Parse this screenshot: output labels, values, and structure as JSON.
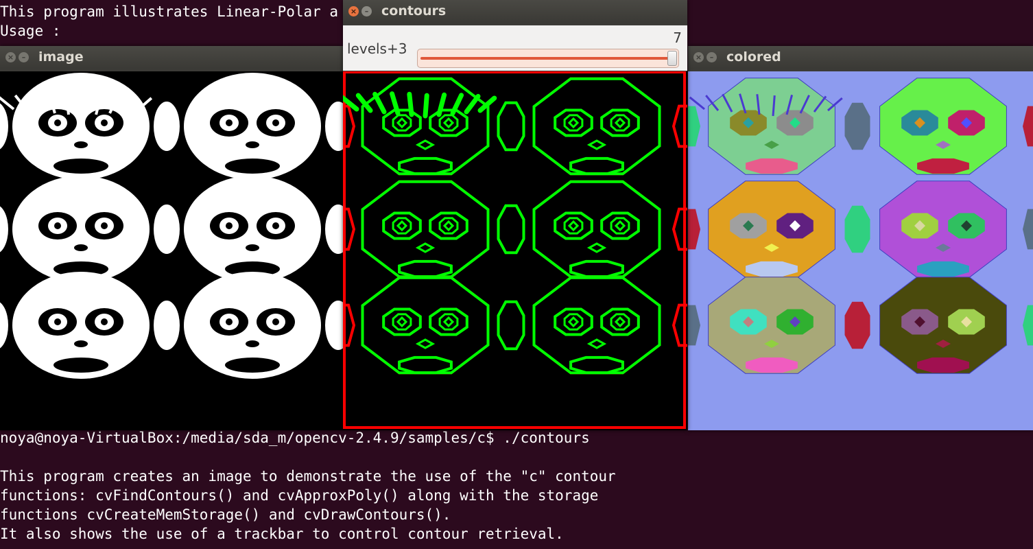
{
  "terminal": {
    "top_lines": [
      "This program illustrates Linear-Polar a",
      "Usage :"
    ],
    "bottom_lines": [
      "noya@noya-VirtualBox:/media/sda_m/opencv-2.4.9/samples/c$ ./contours",
      "",
      "This program creates an image to demonstrate the use of the \"c\" contour",
      "functions: cvFindContours() and cvApproxPoly() along with the storage",
      "functions cvCreateMemStorage() and cvDrawContours().",
      "It also shows the use of a trackbar to control contour retrieval."
    ]
  },
  "windows": {
    "image": {
      "title": "image"
    },
    "contours": {
      "title": "contours",
      "trackbar_label": "levels+3",
      "trackbar_value": "7",
      "trackbar_fraction": 1.0
    },
    "colored": {
      "title": "colored"
    }
  },
  "colors": {
    "terminal_bg": "#2c0a1e",
    "contour_green": "#00ff00",
    "contour_red": "#ff0000",
    "colored_bg": "#8d9bef"
  },
  "colored_faces": [
    {
      "face": "#7dcf92",
      "eyeL": "#8a8a2a",
      "pupilL": "#2aa0a0",
      "eyeR": "#8c8c8c",
      "pupilR": "#22dd88",
      "nose": "#48a048",
      "mouth": "#e85c8c"
    },
    {
      "face": "#66f04a",
      "eyeL": "#2a8a9a",
      "pupilL": "#d89020",
      "eyeR": "#c0206a",
      "pupilR": "#5050ff",
      "nose": "#a070c0",
      "mouth": "#c02040"
    },
    {
      "face": "#e0a020",
      "eyeL": "#a0a0a0",
      "pupilL": "#2a7a50",
      "eyeR": "#602080",
      "pupilR": "#ffffff",
      "nose": "#f0f050",
      "mouth": "#b8c8f0"
    },
    {
      "face": "#b050d8",
      "eyeL": "#a0d040",
      "pupilL": "#d8d8a0",
      "eyeR": "#30c060",
      "pupilR": "#204030",
      "nose": "#6a7a9a",
      "mouth": "#2aa0c0"
    },
    {
      "face": "#a8a878",
      "eyeL": "#40e0c0",
      "pupilL": "#c08080",
      "eyeR": "#30b030",
      "pupilR": "#6040c0",
      "nose": "#90d040",
      "mouth": "#f05cc0"
    },
    {
      "face": "#4a4a0c",
      "eyeL": "#8a5a8a",
      "pupilL": "#501030",
      "eyeR": "#a0d050",
      "pupilR": "#e8e0a0",
      "nose": "#a02040",
      "mouth": "#a01050"
    }
  ],
  "colored_bridges": [
    "#5a7088",
    "#30d080",
    "#b82038"
  ]
}
